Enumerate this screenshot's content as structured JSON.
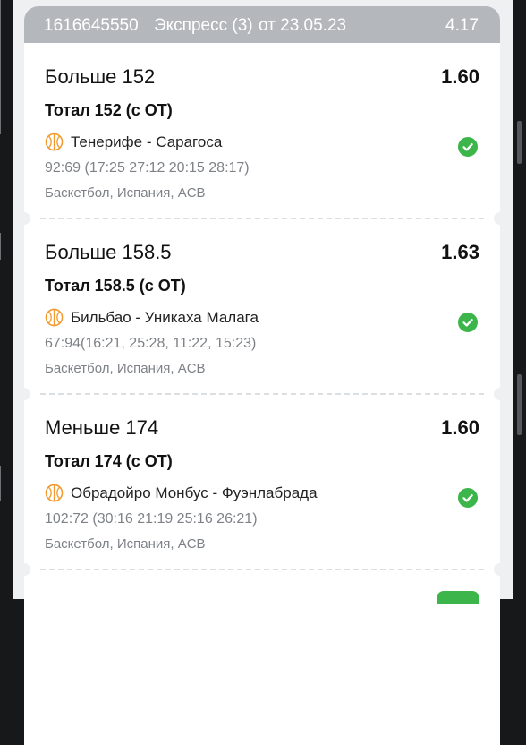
{
  "header": {
    "id": "1616645550",
    "bet_type": "Экспресс (3)",
    "date": "от 23.05.23",
    "total_coef": "4.17"
  },
  "selections": [
    {
      "title": "Больше 152",
      "coef": "1.60",
      "market": "Тотал 152 (с ОТ)",
      "teams": "Тенерифе - Сарагоса",
      "score": "92:69 (17:25 27:12 20:15 28:17)",
      "league": "Баскетбол, Испания, ACB",
      "status": "won"
    },
    {
      "title": "Больше 158.5",
      "coef": "1.63",
      "market": "Тотал 158.5 (с ОТ)",
      "teams": "Бильбао - Уникаха Малага",
      "score": "67:94(16:21, 25:28, 11:22, 15:23)",
      "league": "Баскетбол, Испания, ACB",
      "status": "won"
    },
    {
      "title": "Меньше 174",
      "coef": "1.60",
      "market": "Тотал 174 (с ОТ)",
      "teams": "Обрадойро Монбус - Фуэнлабрада",
      "score": "102:72 (30:16 21:19 25:16 26:21)",
      "league": "Баскетбол, Испания, ACB",
      "status": "won"
    }
  ],
  "icons": {
    "sport": "basketball-icon",
    "status": "check-circle-icon"
  },
  "colors": {
    "header_bg": "#b4b8bd",
    "win_green": "#3cb54a",
    "ball_orange": "#f29a2e",
    "muted_text": "#7e8287"
  }
}
